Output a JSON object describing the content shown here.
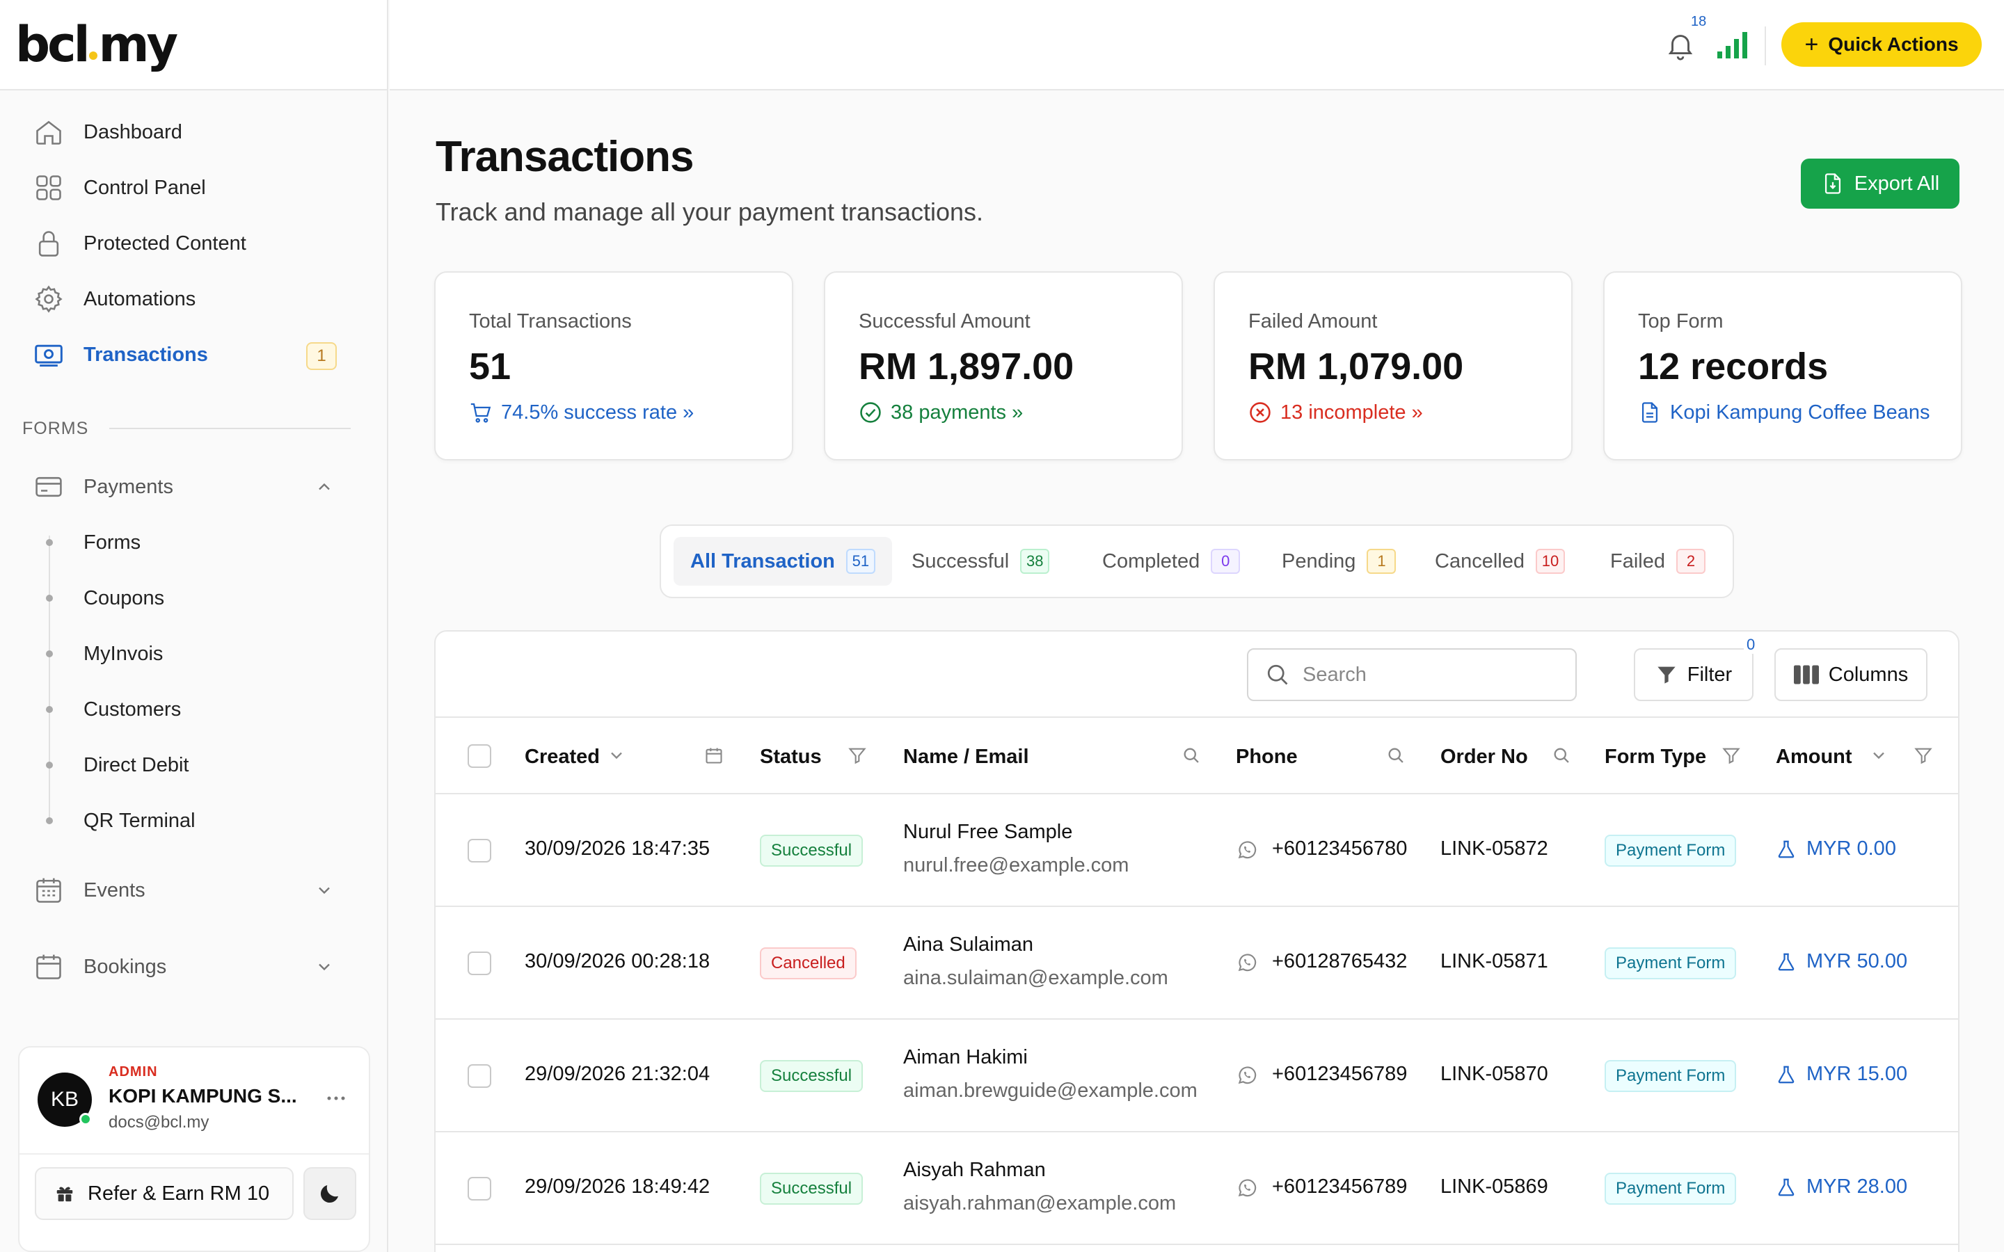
{
  "brand": {
    "logo_left": "bcl",
    "logo_right": "my"
  },
  "sidebar": {
    "nav": [
      {
        "label": "Dashboard",
        "icon": "home-icon"
      },
      {
        "label": "Control Panel",
        "icon": "grid-icon"
      },
      {
        "label": "Protected Content",
        "icon": "lock-icon"
      },
      {
        "label": "Automations",
        "icon": "gear-icon"
      },
      {
        "label": "Transactions",
        "icon": "money-icon",
        "badge": "1",
        "active": true
      }
    ],
    "forms_section": "FORMS",
    "payments": {
      "label": "Payments",
      "items": [
        "Forms",
        "Coupons",
        "MyInvois",
        "Customers",
        "Direct Debit",
        "QR Terminal"
      ]
    },
    "events_label": "Events",
    "bookings_label": "Bookings",
    "user": {
      "initials": "KB",
      "role": "ADMIN",
      "name": "KOPI KAMPUNG S...",
      "email": "docs@bcl.my",
      "refer_label": "Refer & Earn RM 10"
    }
  },
  "topbar": {
    "notifications_count": "18",
    "quick_actions_label": "Quick Actions"
  },
  "page": {
    "title": "Transactions",
    "subtitle": "Track and manage all your payment transactions.",
    "export_label": "Export All"
  },
  "stats": [
    {
      "title": "Total Transactions",
      "value": "51",
      "footer": "74.5% success rate »",
      "icon": "cart-icon",
      "color": "#1f63c6"
    },
    {
      "title": "Successful Amount",
      "value": "RM 1,897.00",
      "footer": "38 payments »",
      "icon": "check-circle-icon",
      "color": "#15803d"
    },
    {
      "title": "Failed Amount",
      "value": "RM 1,079.00",
      "footer": "13 incomplete »",
      "icon": "x-circle-icon",
      "color": "#d92d20"
    },
    {
      "title": "Top Form",
      "value": "12 records",
      "footer": "Kopi Kampung Coffee Beans",
      "icon": "document-icon",
      "color": "#1f63c6"
    }
  ],
  "tabs": [
    {
      "label": "All Transaction",
      "count": "51"
    },
    {
      "label": "Successful",
      "count": "38"
    },
    {
      "label": "Completed",
      "count": "0"
    },
    {
      "label": "Pending",
      "count": "1"
    },
    {
      "label": "Cancelled",
      "count": "10"
    },
    {
      "label": "Failed",
      "count": "2"
    }
  ],
  "toolbar": {
    "search_placeholder": "Search",
    "filter_label": "Filter",
    "filter_count": "0",
    "columns_label": "Columns"
  },
  "table": {
    "headers": {
      "created": "Created",
      "status": "Status",
      "name_email": "Name / Email",
      "phone": "Phone",
      "order_no": "Order No",
      "form_type": "Form Type",
      "amount": "Amount"
    },
    "rows": [
      {
        "created": "30/09/2026 18:47:35",
        "status": "Successful",
        "name": "Nurul Free Sample",
        "email": "nurul.free@example.com",
        "phone": "+60123456780",
        "order_no": "LINK-05872",
        "form_type": "Payment Form",
        "amount": "MYR 0.00"
      },
      {
        "created": "30/09/2026 00:28:18",
        "status": "Cancelled",
        "name": "Aina Sulaiman",
        "email": "aina.sulaiman@example.com",
        "phone": "+60128765432",
        "order_no": "LINK-05871",
        "form_type": "Payment Form",
        "amount": "MYR 50.00"
      },
      {
        "created": "29/09/2026 21:32:04",
        "status": "Successful",
        "name": "Aiman Hakimi",
        "email": "aiman.brewguide@example.com",
        "phone": "+60123456789",
        "order_no": "LINK-05870",
        "form_type": "Payment Form",
        "amount": "MYR 15.00"
      },
      {
        "created": "29/09/2026 18:49:42",
        "status": "Successful",
        "name": "Aisyah Rahman",
        "email": "aisyah.rahman@example.com",
        "phone": "+60123456789",
        "order_no": "LINK-05869",
        "form_type": "Payment Form",
        "amount": "MYR 28.00"
      }
    ]
  }
}
